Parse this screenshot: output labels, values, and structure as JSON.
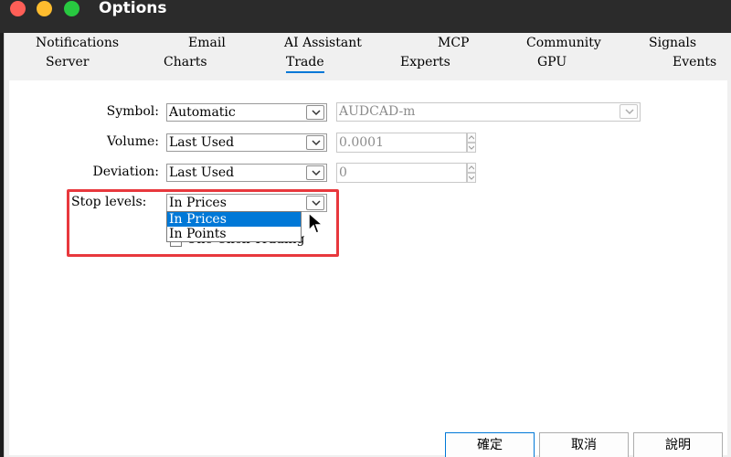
{
  "window": {
    "title": "Options"
  },
  "tabs": {
    "row1": [
      "Notifications",
      "Email",
      "AI Assistant",
      "MCP",
      "Community",
      "Signals"
    ],
    "row2": [
      "Server",
      "Charts",
      "Trade",
      "Experts",
      "GPU",
      "Events"
    ],
    "active": "Trade"
  },
  "form": {
    "symbol": {
      "label": "Symbol:",
      "mode": "Automatic",
      "value": "AUDCAD-m"
    },
    "volume": {
      "label": "Volume:",
      "mode": "Last Used",
      "value": "0.0001"
    },
    "deviation": {
      "label": "Deviation:",
      "mode": "Last Used",
      "value": "0"
    },
    "stop_levels": {
      "label": "Stop levels:",
      "selected": "In Prices",
      "options": [
        "In Prices",
        "In Points"
      ],
      "highlighted_option": "In Prices"
    },
    "one_click": {
      "label": "One Click Trading",
      "checked": false
    }
  },
  "buttons": {
    "ok": "確定",
    "cancel": "取消",
    "help": "說明"
  },
  "colors": {
    "accent": "#0078d7",
    "annotation": "#e8383d"
  }
}
